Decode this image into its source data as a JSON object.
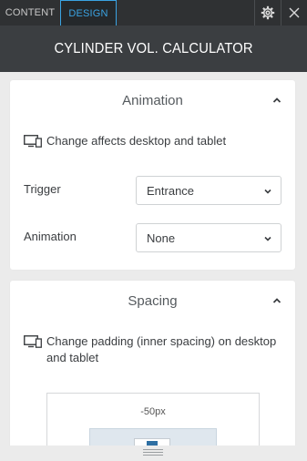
{
  "tabs": [
    {
      "label": "CONTENT",
      "active": false
    },
    {
      "label": "DESIGN",
      "active": true
    }
  ],
  "toolbar": {
    "settings_icon": "gear-icon",
    "close_icon": "close-icon"
  },
  "title": "CYLINDER VOL. CALCULATOR",
  "animation_section": {
    "header": "Animation",
    "note": "Change affects desktop and tablet",
    "trigger_label": "Trigger",
    "trigger_value": "Entrance",
    "animation_label": "Animation",
    "animation_value": "None"
  },
  "spacing_section": {
    "header": "Spacing",
    "note": "Change padding (inner spacing) on desktop and tablet",
    "top_padding": "-50px"
  },
  "colors": {
    "accent": "#3aa3e3",
    "topbar": "#2f3133",
    "titlebar": "#3b3e41",
    "background": "#ebebeb"
  }
}
